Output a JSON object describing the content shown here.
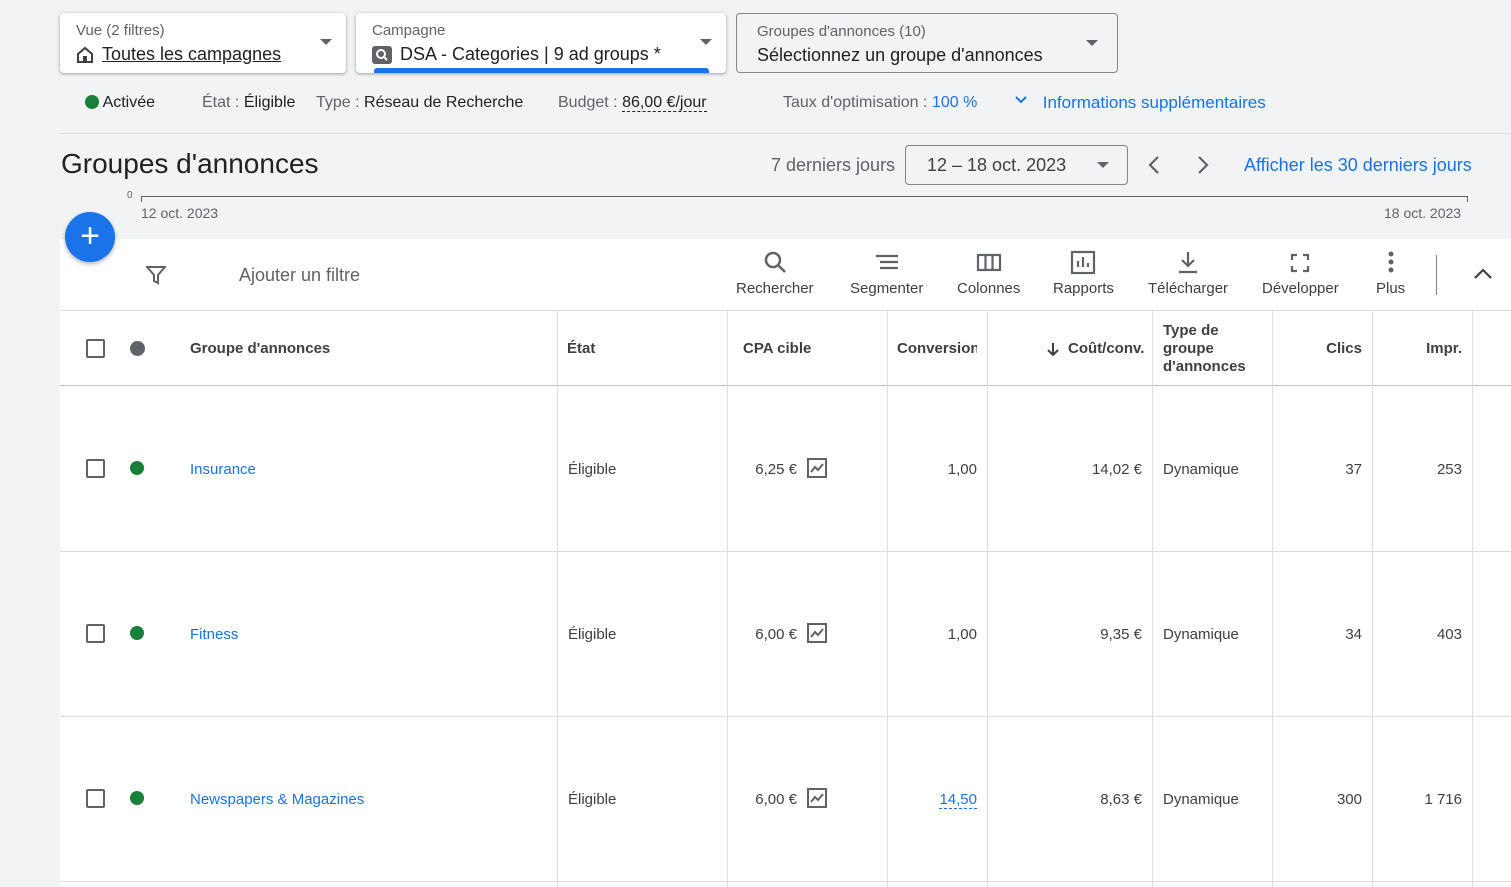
{
  "selectors": {
    "view": {
      "label": "Vue (2 filtres)",
      "value": "Toutes les campagnes"
    },
    "campaign": {
      "label": "Campagne",
      "value": "DSA - Categories | 9 ad groups *"
    },
    "adgroups": {
      "label": "Groupes d'annonces (10)",
      "value": "Sélectionnez un groupe d'annonces"
    }
  },
  "status": {
    "active": "Activée",
    "state_label": "État :",
    "state_value": "Éligible",
    "type_label": "Type :",
    "type_value": "Réseau de Recherche",
    "budget_label": "Budget :",
    "budget_value": "86,00 €/jour",
    "opt_label": "Taux d'optimisation :",
    "opt_value": "100 %",
    "more_info": "Informations supplémentaires"
  },
  "header": {
    "title": "Groupes d'annonces",
    "range_label": "7 derniers jours",
    "date_range": "12 – 18 oct. 2023",
    "show_30": "Afficher les 30 derniers jours"
  },
  "timeline": {
    "zero": "0",
    "start": "12 oct. 2023",
    "end": "18 oct. 2023"
  },
  "toolbar": {
    "add_filter": "Ajouter un filtre",
    "search": "Rechercher",
    "segment": "Segmenter",
    "columns": "Colonnes",
    "reports": "Rapports",
    "download": "Télécharger",
    "expand": "Développer",
    "more": "Plus"
  },
  "table": {
    "headers": {
      "name": "Groupe d'annonces",
      "state": "État",
      "cpa": "CPA cible",
      "conversions": "Conversions",
      "cost_conv": "Coût/conv.",
      "type_1": "Type de",
      "type_2": "groupe",
      "type_3": "d'annonces",
      "clicks": "Clics",
      "impr": "Impr."
    },
    "rows": [
      {
        "name": "Insurance",
        "state": "Éligible",
        "cpa": "6,25 €",
        "conversions": "1,00",
        "cost_conv": "14,02 €",
        "type": "Dynamique",
        "clicks": "37",
        "impr": "253"
      },
      {
        "name": "Fitness",
        "state": "Éligible",
        "cpa": "6,00 €",
        "conversions": "1,00",
        "cost_conv": "9,35 €",
        "type": "Dynamique",
        "clicks": "34",
        "impr": "403"
      },
      {
        "name": "Newspapers & Magazines",
        "state": "Éligible",
        "cpa": "6,00 €",
        "conversions": "14,50",
        "cost_conv": "8,63 €",
        "type": "Dynamique",
        "clicks": "300",
        "impr": "1 716"
      }
    ]
  },
  "colors": {
    "accent": "#1a73e8",
    "active_dot": "#188038"
  }
}
